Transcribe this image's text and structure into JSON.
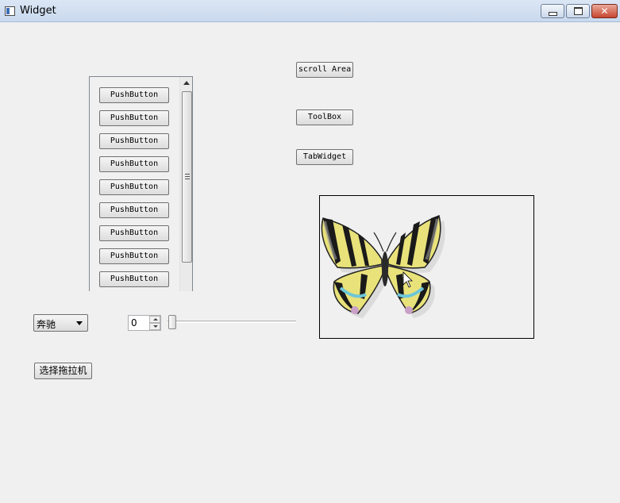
{
  "window": {
    "title": "Widget"
  },
  "scroll_area": {
    "buttons": [
      "PushButton",
      "PushButton",
      "PushButton",
      "PushButton",
      "PushButton",
      "PushButton",
      "PushButton",
      "PushButton",
      "PushButton"
    ]
  },
  "buttons": {
    "scroll_area": "scroll Area",
    "toolbox": "ToolBox",
    "tabwidget": "TabWidget",
    "select_tractor": "选择拖拉机"
  },
  "combo": {
    "selected": "奔驰"
  },
  "spinbox": {
    "value": "0"
  },
  "slider": {
    "value": 0
  },
  "colors": {
    "titlebar": "#c9d9ee",
    "window_bg": "#f0f0f0",
    "close_button": "#c7462f"
  },
  "icons": [
    "app-icon",
    "minimize-icon",
    "maximize-icon",
    "close-icon",
    "scroll-up-icon",
    "dropdown-arrow-icon",
    "spin-up-icon",
    "spin-down-icon",
    "butterfly-image"
  ]
}
